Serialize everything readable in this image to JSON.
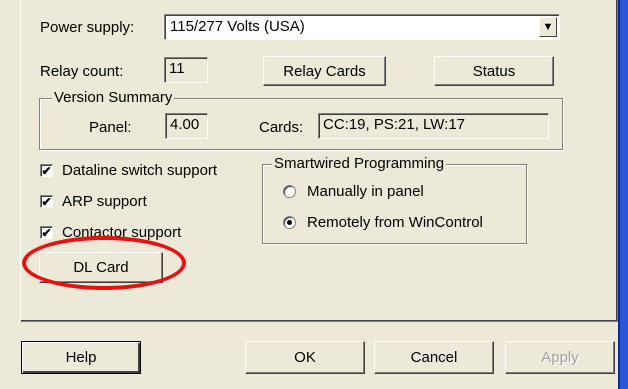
{
  "form": {
    "power_supply_label": "Power supply:",
    "power_supply_value": "115/277 Volts (USA)",
    "relay_count_label": "Relay count:",
    "relay_count_value": "11",
    "relay_cards_button": "Relay Cards",
    "status_button": "Status"
  },
  "version_summary": {
    "title": "Version Summary",
    "panel_label": "Panel:",
    "panel_value": "4.00",
    "cards_label": "Cards:",
    "cards_value": "CC:19,  PS:21,  LW:17"
  },
  "options": [
    {
      "label": "Dataline switch support",
      "checked": true
    },
    {
      "label": "ARP support",
      "checked": true
    },
    {
      "label": "Contactor support",
      "checked": true
    }
  ],
  "dl_card_button": "DL Card",
  "smartwired": {
    "title": "Smartwired Programming",
    "options": [
      {
        "label": "Manually in panel",
        "selected": false
      },
      {
        "label": "Remotely from WinControl",
        "selected": true
      }
    ]
  },
  "footer": {
    "help": "Help",
    "ok": "OK",
    "cancel": "Cancel",
    "apply": "Apply"
  },
  "icons": {
    "dropdown": "chevron-down-icon",
    "check": "check-icon"
  },
  "colors": {
    "dialog_bg": "#ece9d8",
    "annotation_red": "#e81010",
    "window_blue": "#2b56d6"
  }
}
